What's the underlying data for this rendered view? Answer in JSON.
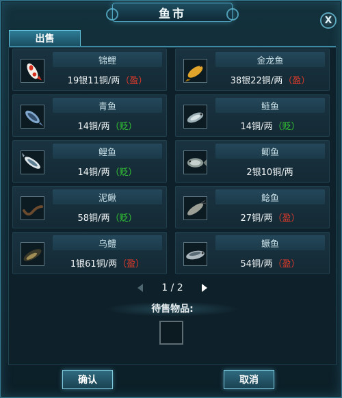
{
  "window": {
    "title": "鱼市",
    "close_glyph": "X"
  },
  "tabs": [
    {
      "label": "出售",
      "active": true
    }
  ],
  "items": [
    {
      "name": "锦鲤",
      "price": "19银11铜/两",
      "tag": "（盈）",
      "tag_color": "#e23a2a",
      "icon": "koi-icon"
    },
    {
      "name": "金龙鱼",
      "price": "38银22铜/两",
      "tag": "（盈）",
      "tag_color": "#e23a2a",
      "icon": "arowana-icon"
    },
    {
      "name": "青鱼",
      "price": "14铜/两",
      "tag": "（贬）",
      "tag_color": "#33c833",
      "icon": "black-carp-icon"
    },
    {
      "name": "鲢鱼",
      "price": "14铜/两",
      "tag": "（贬）",
      "tag_color": "#33c833",
      "icon": "silver-carp-icon"
    },
    {
      "name": "鲤鱼",
      "price": "14铜/两",
      "tag": "（贬）",
      "tag_color": "#33c833",
      "icon": "carp-icon"
    },
    {
      "name": "鲫鱼",
      "price": "2银10铜/两",
      "tag": "",
      "tag_color": "#33c833",
      "icon": "crucian-icon"
    },
    {
      "name": "泥鳅",
      "price": "58铜/两",
      "tag": "（贬）",
      "tag_color": "#33c833",
      "icon": "loach-icon"
    },
    {
      "name": "鲶鱼",
      "price": "27铜/两",
      "tag": "（盈）",
      "tag_color": "#e23a2a",
      "icon": "catfish-icon"
    },
    {
      "name": "乌鳢",
      "price": "1银61铜/两",
      "tag": "（盈）",
      "tag_color": "#e23a2a",
      "icon": "snakehead-icon"
    },
    {
      "name": "鳜鱼",
      "price": "54铜/两",
      "tag": "（盈）",
      "tag_color": "#e23a2a",
      "icon": "mandarin-fish-icon"
    }
  ],
  "pager": {
    "text": "1 / 2"
  },
  "pending": {
    "label": "待售物品:"
  },
  "buttons": {
    "confirm": "确认",
    "cancel": "取消"
  }
}
